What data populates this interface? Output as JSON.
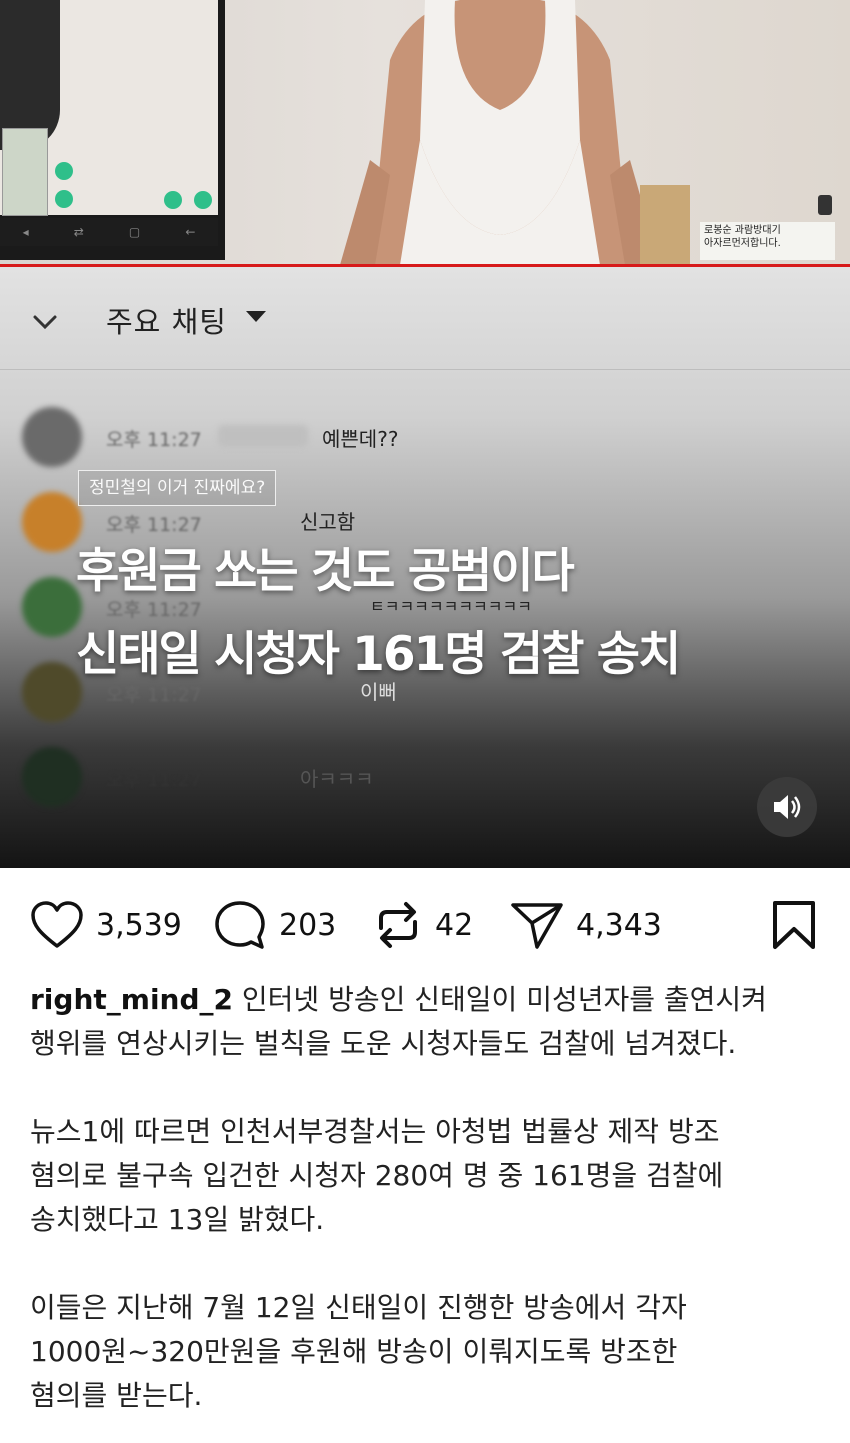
{
  "video": {
    "caption_card": "로봉순 과람방대기\n아자르먼저합니다.",
    "phone_nav": [
      "◂",
      "⇄",
      "▢",
      "←"
    ]
  },
  "chat": {
    "title": "주요 채팅",
    "messages": [
      {
        "time": "오후 11:27",
        "text": "예쁜데??"
      },
      {
        "time": "오후 11:27",
        "text": "신고함"
      },
      {
        "time": "오후 11:27",
        "text": "ㅌㅋㅋㅋㅋㅋㅋㅋㅋㅋㅋ"
      },
      {
        "time": "오후 11:27",
        "text": "이뻐"
      },
      {
        "time": "오후 11:27",
        "text": "아ㅋㅋㅋ"
      }
    ]
  },
  "overlay": {
    "tag": "정민철의 이거 진짜에요?",
    "headline_line1": "후원금 쏘는 것도 공범이다",
    "headline_line2": "신태일 시청자 161명 검찰 송치"
  },
  "actions": {
    "likes": "3,539",
    "comments": "203",
    "reposts": "42",
    "shares": "4,343"
  },
  "post": {
    "username": "right_mind_2",
    "para1_text": " 인터넷 방송인 신태일이 미성년자를 출연시켜\n행위를 연상시키는 벌칙을 도운 시청자들도 검찰에 넘겨졌다.",
    "para2": "뉴스1에 따르면 인천서부경찰서는 아청법 법률상 제작 방조\n혐의로 불구속 입건한 시청자 280여 명 중 161명을 검찰에\n송치했다고 13일 밝혔다.",
    "para3": "이들은 지난해 7월 12일 신태일이 진행한 방송에서 각자\n1000원~320만원을 후원해 방송이 이뤄지도록 방조한\n혐의를 받는다."
  }
}
